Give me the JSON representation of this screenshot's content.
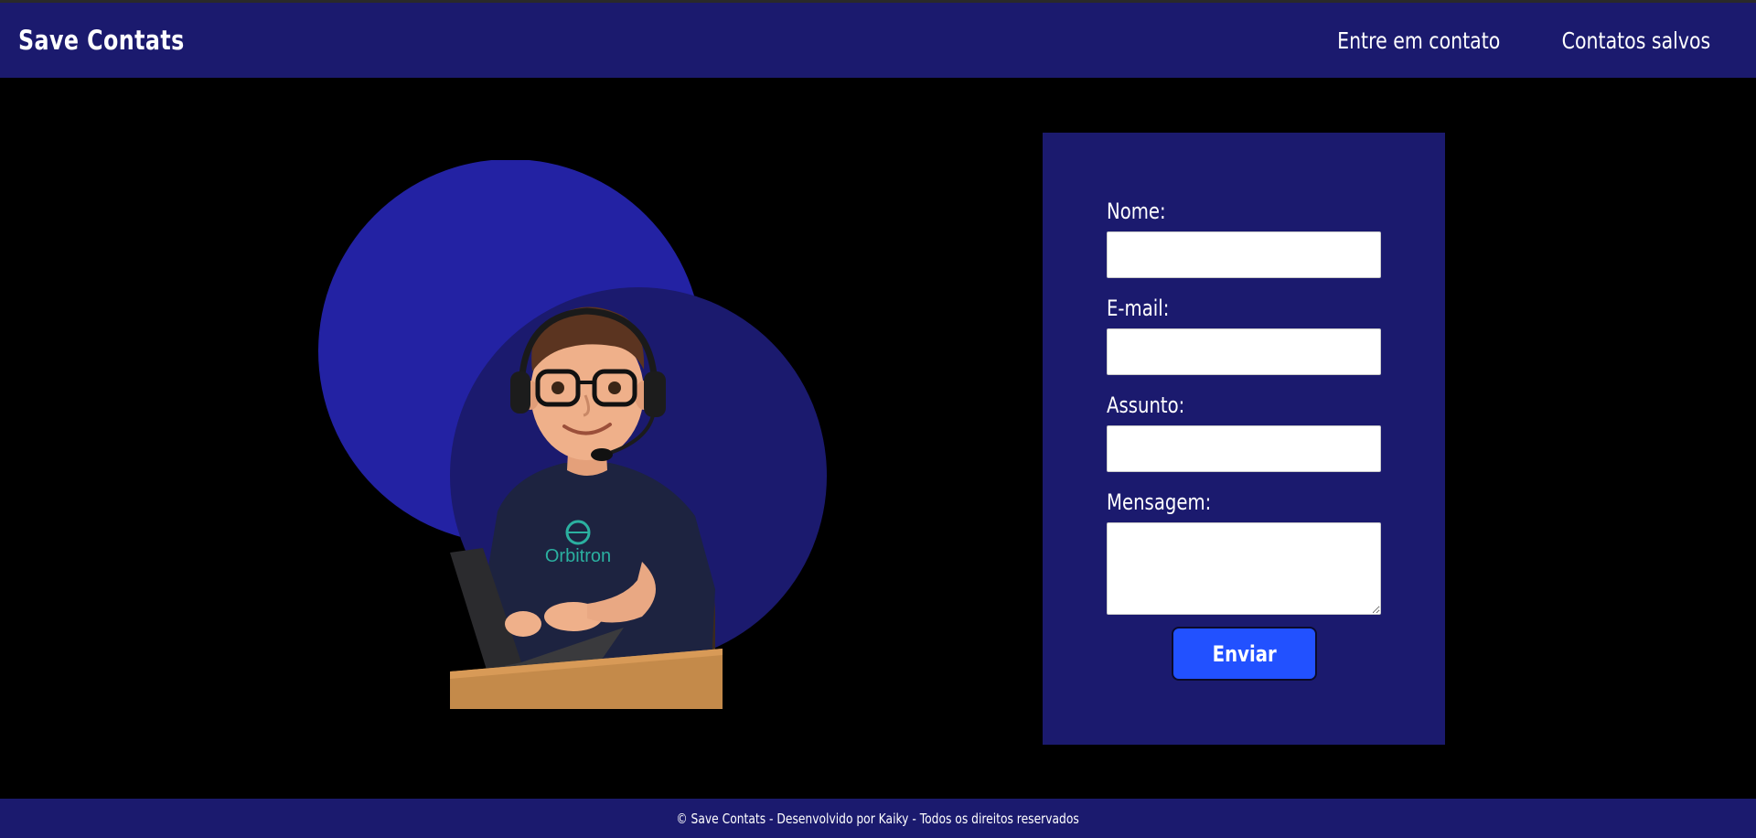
{
  "header": {
    "brand": "Save Contats",
    "nav": [
      {
        "label": "Entre em contato"
      },
      {
        "label": "Contatos salvos"
      }
    ]
  },
  "hero": {
    "shirt_text": "Orbitron",
    "colors": {
      "circle_back": "#2322a3",
      "circle_front": "#1b1a6e"
    }
  },
  "form": {
    "fields": [
      {
        "label": "Nome:",
        "value": ""
      },
      {
        "label": "E-mail:",
        "value": ""
      },
      {
        "label": "Assunto:",
        "value": ""
      },
      {
        "label": "Mensagem:",
        "value": ""
      }
    ],
    "submit_label": "Enviar"
  },
  "footer": {
    "text": "© Save Contats - Desenvolvido por Kaiky - Todos os direitos reservados"
  },
  "colors": {
    "nav_bg": "#1b1a6e",
    "page_bg": "#000000",
    "button": "#2251ff"
  }
}
